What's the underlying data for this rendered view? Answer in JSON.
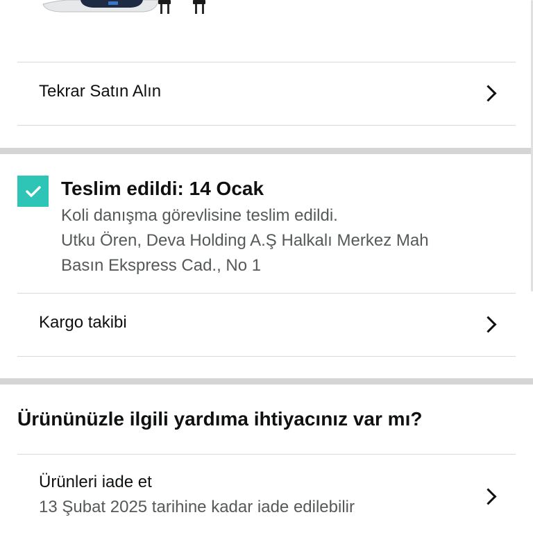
{
  "buy_again": {
    "label": "Tekrar Satın Alın"
  },
  "delivery": {
    "status_title": "Teslim edildi: 14 Ocak",
    "detail": "Koli danışma görevlisine teslim edildi.",
    "address_line1": "Utku Ören, Deva Holding A.Ş Halkalı Merkez Mah",
    "address_line2": "Basın Ekspress Cad., No 1"
  },
  "tracking": {
    "label": "Kargo takibi"
  },
  "help": {
    "title": "Ürününüzle ilgili yardıma ihtiyacınız var mı?",
    "return_label": "Ürünleri iade et",
    "return_deadline": "13 Şubat 2025 tarihine kadar iade edilebilir"
  },
  "colors": {
    "accent_check": "#2ec4b6",
    "text": "#0f1111",
    "secondary_text": "#565959",
    "divider": "#d5d9d9"
  },
  "icons": [
    "checkmark-icon",
    "chevron-right-icon"
  ]
}
